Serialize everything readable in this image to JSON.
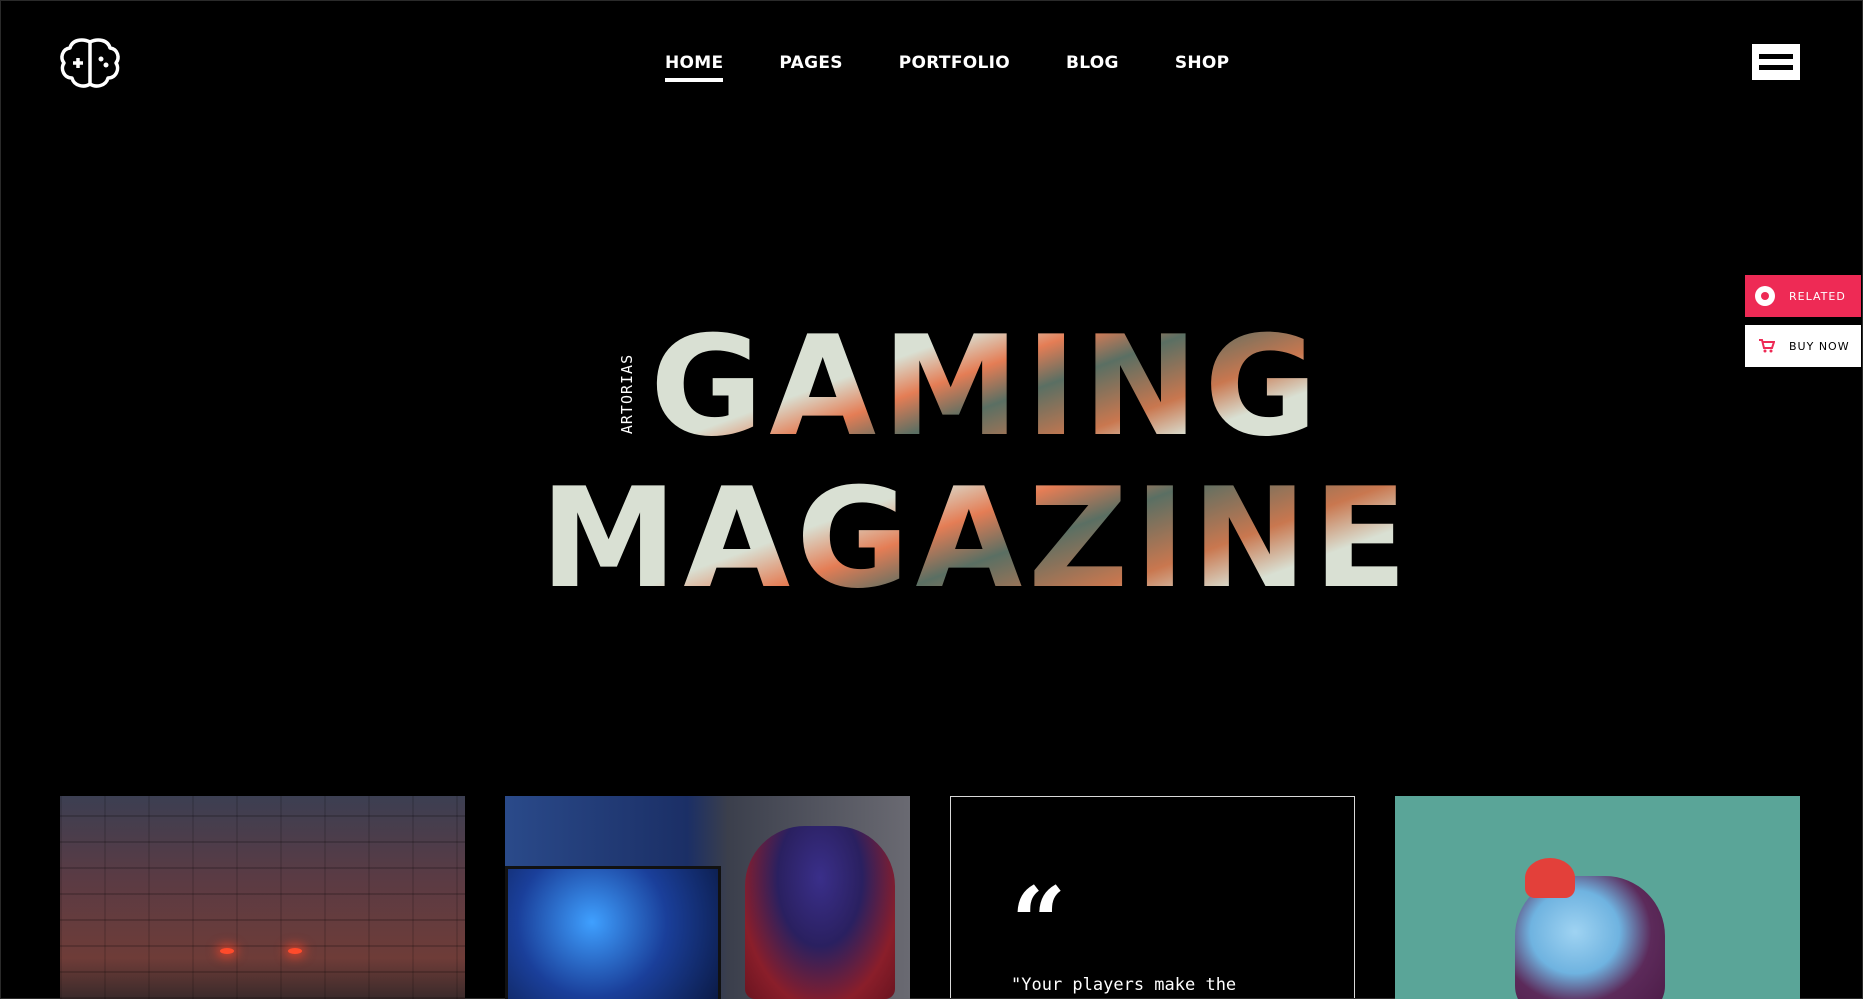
{
  "header": {
    "logo_icon": "brain-gamepad-icon",
    "nav": [
      "HOME",
      "PAGES",
      "PORTFOLIO",
      "BLOG",
      "SHOP"
    ],
    "active_nav": "HOME",
    "menu_icon": "menu-icon"
  },
  "side_buttons": {
    "related_label": "RELATED",
    "buy_label": "BUY NOW"
  },
  "hero": {
    "small_vertical": "ARTORIAS",
    "line1": "GAMING",
    "line2": "MAGAZINE"
  },
  "cards": {
    "quote_text": "\"Your players make the"
  },
  "colors": {
    "background": "#000000",
    "hero_text": "#d9e0d3",
    "accent": "#ee2a55",
    "nav_text": "#ffffff"
  }
}
